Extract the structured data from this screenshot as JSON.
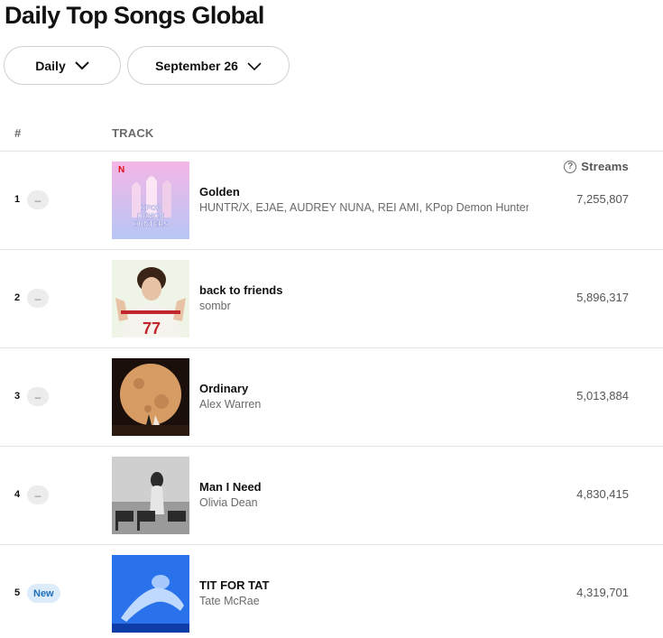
{
  "page": {
    "title": "Daily Top Songs Global"
  },
  "filters": {
    "period": "Daily",
    "date": "September 26"
  },
  "table": {
    "headers": {
      "rank": "#",
      "track": "TRACK",
      "streams": "Streams",
      "help_icon": "?"
    },
    "rows": [
      {
        "rank": "1",
        "change": "–",
        "change_type": "same",
        "title": "Golden",
        "artists": "HUNTR/X, EJAE, AUDREY NUNA, REI AMI, KPop Demon Hunters Cast",
        "streams": "7,255,807",
        "cover_icon": "kpop-demon-hunters-cover",
        "badge": "N",
        "cover_text": [
          "KPOP",
          "DEMON",
          "HUNTERS"
        ]
      },
      {
        "rank": "2",
        "change": "–",
        "change_type": "same",
        "title": "back to friends",
        "artists": "sombr",
        "streams": "5,896,317",
        "cover_icon": "sombr-cover",
        "jersey": "77"
      },
      {
        "rank": "3",
        "change": "–",
        "change_type": "same",
        "title": "Ordinary",
        "artists": "Alex Warren",
        "streams": "5,013,884",
        "cover_icon": "alex-warren-cover"
      },
      {
        "rank": "4",
        "change": "–",
        "change_type": "same",
        "title": "Man I Need",
        "artists": "Olivia Dean",
        "streams": "4,830,415",
        "cover_icon": "olivia-dean-cover"
      },
      {
        "rank": "5",
        "change": "New",
        "change_type": "new",
        "title": "TIT FOR TAT",
        "artists": "Tate McRae",
        "streams": "4,319,701",
        "cover_icon": "tate-mcrae-cover"
      }
    ]
  },
  "colors": {
    "new_badge_bg": "#dcecfb",
    "new_badge_text": "#1f6fb8",
    "netflix_red": "#e50914"
  }
}
